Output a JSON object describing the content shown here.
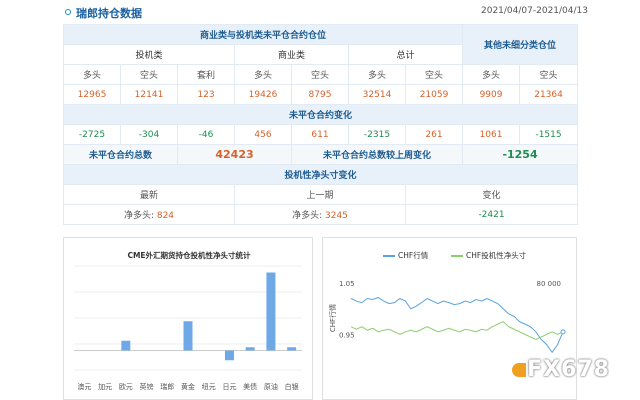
{
  "header": {
    "title": "瑞郎持仓数据",
    "date_range": "2021/04/07-2021/04/13"
  },
  "table": {
    "section_noncommercial": "商业类与投机类未平仓合约仓位",
    "section_other": "其他未细分类仓位",
    "groups": [
      "投机类",
      "商业类",
      "总计"
    ],
    "cols": [
      "多头",
      "空头",
      "套利",
      "多头",
      "空头",
      "多头",
      "空头",
      "多头",
      "空头"
    ],
    "values": [
      "12965",
      "12141",
      "123",
      "19426",
      "8795",
      "32514",
      "21059",
      "9909",
      "21364"
    ],
    "section_change": "未平仓合约变化",
    "changes": [
      "-2725",
      "-304",
      "-46",
      "456",
      "611",
      "-2315",
      "261",
      "1061",
      "-1515"
    ],
    "total_oi_label": "未平仓合约总数",
    "total_oi_value": "42423",
    "oi_change_label": "未平仓合约总数较上周变化",
    "oi_change_value": "-1254",
    "section_spec": "投机性净头寸变化",
    "spec_cols": [
      "最新",
      "上一期",
      "变化"
    ],
    "spec_latest_label": "净多头:",
    "spec_latest_value": "824",
    "spec_prev_label": "净多头:",
    "spec_prev_value": "3245",
    "spec_change_value": "-2421"
  },
  "chart_data": [
    {
      "type": "bar",
      "title": "CME外汇期货持仓投机性净头寸统计",
      "categories": [
        "澳元",
        "加元",
        "欧元",
        "英镑",
        "瑞郎",
        "黄金",
        "纽元",
        "日元",
        "美债",
        "原油",
        "白银"
      ],
      "values": [
        0,
        0,
        3,
        0,
        0,
        9,
        0,
        -3,
        1,
        24,
        1
      ],
      "ylim": [
        -6,
        26
      ],
      "color": "#6fa8e6"
    },
    {
      "type": "line",
      "legend": [
        "CHF行情",
        "CHF投机性净头寸"
      ],
      "colors": [
        "#5aa3e0",
        "#8ccf6f"
      ],
      "ylabel_left": "CHF行情",
      "y_left_ticks": [
        "1.05",
        "0.95"
      ],
      "y_right_ticks": [
        "80 000"
      ],
      "ylim_left": [
        0.9,
        1.06
      ],
      "x": [
        0,
        1,
        2,
        3,
        4,
        5,
        6,
        7,
        8,
        9,
        10,
        11,
        12,
        13,
        14,
        15,
        16,
        17,
        18,
        19,
        20,
        21,
        22,
        23,
        24,
        25,
        26,
        27,
        28,
        29,
        30,
        31,
        32,
        33,
        34,
        35,
        36,
        37,
        38,
        39
      ],
      "series": [
        {
          "name": "CHF行情",
          "values": [
            1.02,
            1.015,
            1.012,
            1.02,
            1.018,
            1.022,
            1.015,
            1.01,
            1.012,
            1.02,
            1.015,
            1.0,
            1.005,
            1.012,
            1.02,
            1.015,
            1.01,
            1.015,
            1.012,
            1.008,
            1.01,
            1.015,
            1.012,
            1.018,
            1.015,
            1.02,
            1.015,
            1.01,
            1.0,
            0.99,
            0.985,
            0.975,
            0.97,
            0.965,
            0.955,
            0.94,
            0.93,
            0.915,
            0.93,
            0.955
          ]
        },
        {
          "name": "CHF投机性净头寸",
          "values": [
            0.965,
            0.96,
            0.965,
            0.958,
            0.962,
            0.955,
            0.958,
            0.96,
            0.955,
            0.95,
            0.955,
            0.958,
            0.955,
            0.96,
            0.965,
            0.96,
            0.955,
            0.958,
            0.962,
            0.958,
            0.955,
            0.96,
            0.958,
            0.955,
            0.96,
            0.958,
            0.965,
            0.97,
            0.975,
            0.965,
            0.96,
            0.955,
            0.95,
            0.945,
            0.94,
            0.945,
            0.95,
            0.955,
            0.95,
            0.955
          ]
        }
      ]
    }
  ],
  "watermark": "FX678"
}
